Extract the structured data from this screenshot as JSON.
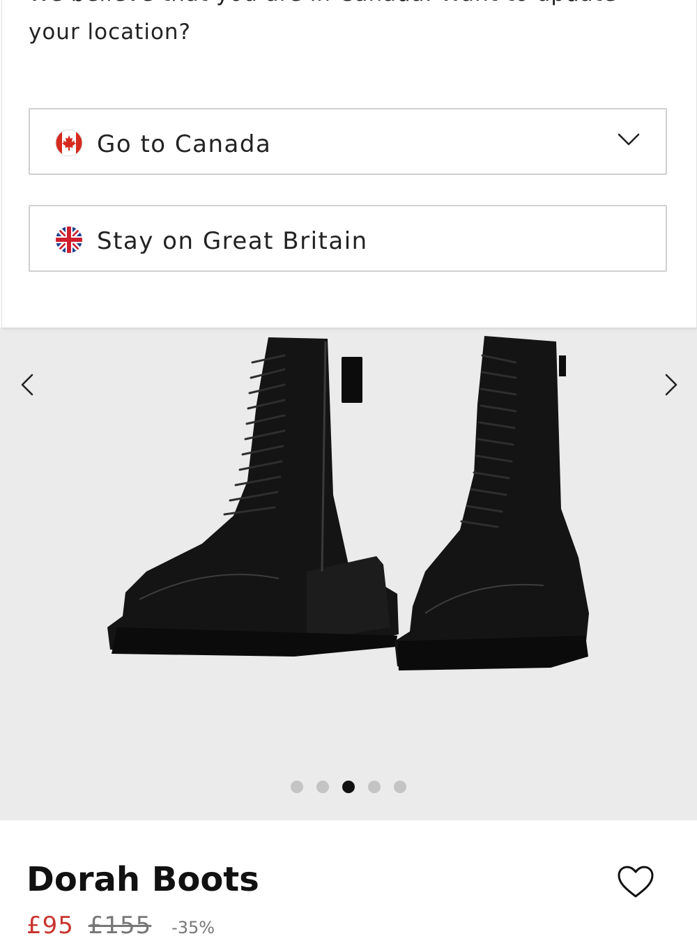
{
  "location_banner": {
    "message": "We believe that you are in Canada. Want to update your location?",
    "go_option": {
      "label": "Go to Canada",
      "flag_icon": "canada-flag-icon",
      "chevron_icon": "chevron-down-icon"
    },
    "stay_option": {
      "label": "Stay on Great Britain",
      "flag_icon": "uk-flag-icon"
    }
  },
  "gallery": {
    "prev_icon": "chevron-left-icon",
    "next_icon": "chevron-right-icon",
    "total_images": 5,
    "active_index": 2,
    "background_color": "#ebebeb"
  },
  "product": {
    "name": "Dorah Boots",
    "price_sale": "£95",
    "price_original": "£155",
    "discount": "-35%",
    "wishlist_icon": "heart-icon"
  },
  "colors": {
    "sale_price": "#c8342f",
    "dot_active": "#111111",
    "dot_inactive": "#c4c4c4"
  }
}
